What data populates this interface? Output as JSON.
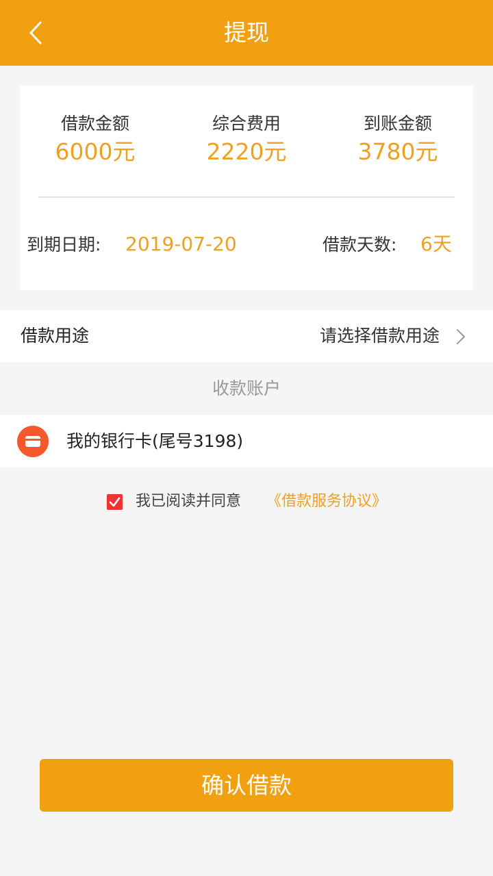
{
  "header": {
    "title": "提现",
    "back_icon": "chevron-left-icon"
  },
  "summary": {
    "loan_amount": {
      "label": "借款金额",
      "value": "6000元"
    },
    "total_fee": {
      "label": "综合费用",
      "value": "2220元"
    },
    "received_amount": {
      "label": "到账金额",
      "value": "3780元"
    },
    "due_date": {
      "label": "到期日期:",
      "value": "2019-07-20"
    },
    "loan_days": {
      "label": "借款天数:",
      "value": "6天"
    }
  },
  "purpose": {
    "label": "借款用途",
    "placeholder": "请选择借款用途",
    "icon": "chevron-right-icon"
  },
  "account": {
    "section_title": "收款账户",
    "bank_card": "我的银行卡(尾号3198)",
    "icon": "bank-card-icon"
  },
  "agreement": {
    "checked": true,
    "text": "我已阅读并同意",
    "link": "《借款服务协议》"
  },
  "confirm_button": "确认借款",
  "colors": {
    "brand": "#f0a010",
    "accent_text": "#f0a020",
    "checkbox": "#ee3333",
    "bank_icon": "#f4582c"
  }
}
